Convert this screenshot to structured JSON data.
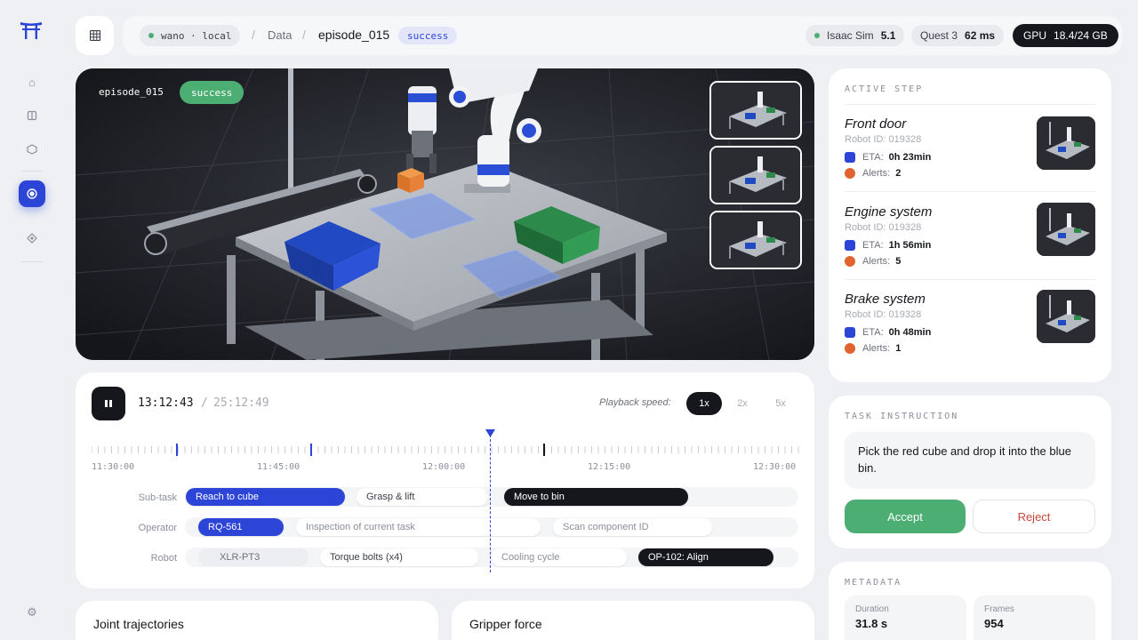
{
  "topbar": {
    "host_chip": "wano · local",
    "crumb_data": "Data",
    "crumb_episode": "episode_015",
    "status_badge": "success",
    "sim_label": "Isaac Sim",
    "sim_version": "5.1",
    "quest_label": "Quest 3",
    "quest_latency": "62 ms",
    "gpu_label": "GPU",
    "gpu_usage": "18.4/24 GB"
  },
  "viewport": {
    "episode_label": "episode_015",
    "status_badge": "success"
  },
  "playback": {
    "current_time": "13:12:43",
    "separator": "/",
    "total_time": "25:12:49",
    "speed_label": "Playback speed:",
    "speeds": [
      "1x",
      "2x",
      "5x"
    ],
    "selected_speed": "1x",
    "ticks": [
      "11:30:00",
      "11:45:00",
      "12:00:00",
      "12:15:00",
      "12:30:00"
    ]
  },
  "tracks": {
    "subtask": {
      "label": "Sub-task",
      "items": [
        "Reach to cube",
        "Grasp & lift",
        "Move to bin"
      ]
    },
    "operator": {
      "label": "Operator",
      "items": [
        "RQ-561",
        "Inspection of current task",
        "Scan component ID"
      ]
    },
    "robot": {
      "label": "Robot",
      "items": [
        "XLR-PT3",
        "Torque bolts (x4)",
        "Cooling cycle",
        "OP-102: Align"
      ]
    }
  },
  "bottom_cards": {
    "joint": "Joint trajectories",
    "gripper": "Gripper force"
  },
  "active_step": {
    "title": "ACTIVE STEP",
    "eta_label": "ETA:",
    "alerts_label": "Alerts:",
    "steps": [
      {
        "name": "Front door",
        "robot_id": "Robot ID: 019328",
        "eta": "0h 23min",
        "alerts": "2"
      },
      {
        "name": "Engine system",
        "robot_id": "Robot ID: 019328",
        "eta": "1h 56min",
        "alerts": "5"
      },
      {
        "name": "Brake system",
        "robot_id": "Robot ID: 019328",
        "eta": "0h 48min",
        "alerts": "1"
      }
    ]
  },
  "task": {
    "title": "TASK INSTRUCTION",
    "instruction": "Pick the red cube and drop it into the blue bin.",
    "accept": "Accept",
    "reject": "Reject"
  },
  "metadata": {
    "title": "METADATA",
    "duration_label": "Duration",
    "duration_value": "31.8 s",
    "frames_label": "Frames",
    "frames_value": "954"
  },
  "colors": {
    "accent": "#2d45d6",
    "success": "#4cae73",
    "alert": "#e0642f",
    "dark": "#15171c"
  },
  "icons": [
    "torii-logo-icon",
    "home-icon",
    "layers-icon",
    "box-icon",
    "record-icon",
    "diamond-icon",
    "settings-icon",
    "grid-icon",
    "pause-icon"
  ]
}
